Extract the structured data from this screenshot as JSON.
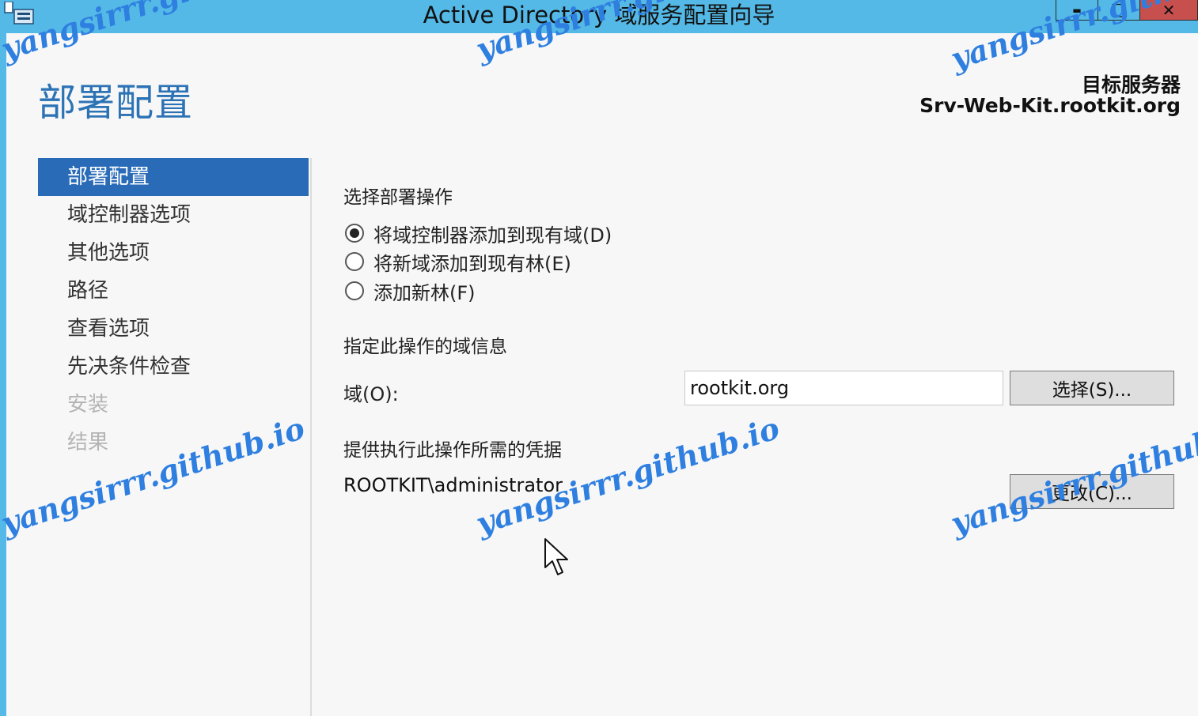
{
  "window": {
    "title": "Active Directory 域服务配置向导",
    "app_icon": "server-manager-icon",
    "controls": {
      "minimize": "▬",
      "maximize": "□",
      "close": "✕"
    },
    "close_color": "#c7504f",
    "titlebar_color": "#54b9e6"
  },
  "header": {
    "page_title": "部署配置",
    "target_label": "目标服务器",
    "target_server": "Srv-Web-Kit.rootkit.org"
  },
  "nav": {
    "items": [
      {
        "label": "部署配置",
        "state": "active"
      },
      {
        "label": "域控制器选项",
        "state": "normal"
      },
      {
        "label": "其他选项",
        "state": "normal"
      },
      {
        "label": "路径",
        "state": "normal"
      },
      {
        "label": "查看选项",
        "state": "normal"
      },
      {
        "label": "先决条件检查",
        "state": "normal"
      },
      {
        "label": "安装",
        "state": "disabled"
      },
      {
        "label": "结果",
        "state": "disabled"
      }
    ],
    "active_color": "#2a6bb8"
  },
  "main": {
    "operation_heading": "选择部署操作",
    "options": [
      {
        "label": "将域控制器添加到现有域(D)",
        "selected": true
      },
      {
        "label": "将新域添加到现有林(E)",
        "selected": false
      },
      {
        "label": "添加新林(F)",
        "selected": false
      }
    ],
    "domain_heading": "指定此操作的域信息",
    "domain_label": "域(O):",
    "domain_value": "rootkit.org",
    "select_button": "选择(S)...",
    "credentials_heading": "提供执行此操作所需的凭据",
    "credential_user": "ROOTKIT\\administrator",
    "change_button": "更改(C)..."
  },
  "watermark": {
    "text": "yangsirrr.github.io",
    "color": "#2e7fe0"
  }
}
